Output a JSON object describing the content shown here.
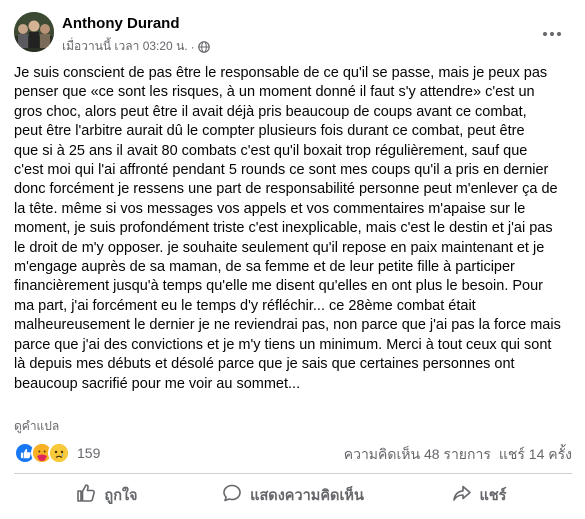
{
  "post": {
    "author": "Anthony Durand",
    "timestamp": "เมื่อวานนี้ เวลา 03:20 น.",
    "separator": "·",
    "privacy_icon": "globe-icon",
    "text": "Je suis conscient de pas être le responsable de ce qu'il se passe, mais je peux pas\npenser que «ce sont les risques, à un moment donné il faut s'y attendre» c'est un\ngros choc, alors peut être il avait déjà pris beaucoup de coups avant ce combat,\npeut être l'arbitre aurait dû le compter plusieurs fois durant ce combat, peut être\nque si à 25 ans il avait 80 combats c'est qu'il boxait trop régulièrement, sauf que\nc'est moi qui l'ai affronté pendant 5 rounds ce sont mes coups qu'il a pris en dernier\ndonc forcément je ressens une part de responsabilité personne peut m'enlever ça de\nla tête. même si vos messages vos appels et vos commentaires m'apaise sur le\nmoment, je suis profondément triste c'est inexplicable, mais c'est le destin et j'ai pas\nle droit de m'y opposer. je souhaite seulement qu'il repose en paix maintenant et je\nm'engage auprès de sa maman, de sa femme et de leur petite fille à participer\nfinancièrement jusqu'à temps qu'elle me disent qu'elles en ont plus le besoin. Pour\nma part, j'ai forcément eu le temps d'y réfléchir... ce 28ème combat était\nmalheureusement le dernier je ne reviendrai pas, non parce que j'ai pas la force mais\nparce que j'ai des convictions et je m'y tiens un minimum. Merci à tout ceux qui sont\nlà depuis mes débuts et désolé parce que je sais que certaines personnes ont\nbeaucoup sacrifié pour me voir au sommet...",
    "translate_label": "ดูคำแปล"
  },
  "stats": {
    "reaction_icons": [
      "like-icon",
      "care-icon",
      "sad-icon"
    ],
    "reaction_count": "159",
    "comments": "ความคิดเห็น 48 รายการ",
    "shares": "แชร์ 14 ครั้ง"
  },
  "actions": {
    "like_label": "ถูกใจ",
    "comment_label": "แสดงความคิดเห็น",
    "share_label": "แชร์"
  },
  "colors": {
    "like_blue": "#1877f2",
    "care_yellow": "#f7b125",
    "secondary_text": "#65676b",
    "primary_text": "#050505"
  }
}
